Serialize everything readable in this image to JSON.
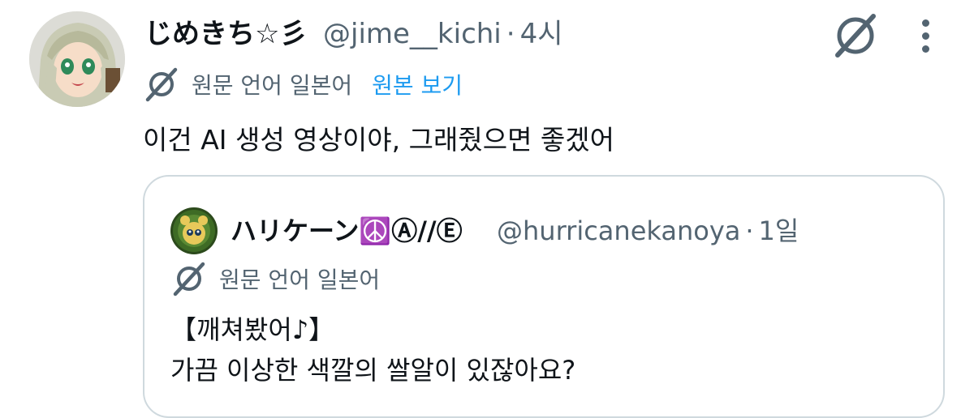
{
  "tweet": {
    "author_name": "じめきち☆彡",
    "handle": "@jime__kichi",
    "separator": "·",
    "time": "4시",
    "translation": {
      "source_language": "원문 언어 일본어",
      "show_original": "원본 보기"
    },
    "text": "이건 AI 생성 영상이야, 그래줬으면 좋겠어"
  },
  "quoted_tweet": {
    "author_name": "ハリケーン☮️Ⓐ//Ⓔ",
    "handle": "@hurricanekanoya",
    "separator": "·",
    "time": "1일",
    "translation": {
      "source_language": "원문 언어 일본어"
    },
    "text_lines": [
      "【깨쳐봤어♪】",
      "가끔 이상한 색깔의 쌀알이 있잖아요?"
    ]
  },
  "icons": {
    "grok": "grok-icon",
    "more": "more-icon",
    "translate": "translate-icon"
  },
  "colors": {
    "text": "#0f1419",
    "secondary": "#536471",
    "link": "#1d9bf0",
    "border": "#cfd9de"
  }
}
